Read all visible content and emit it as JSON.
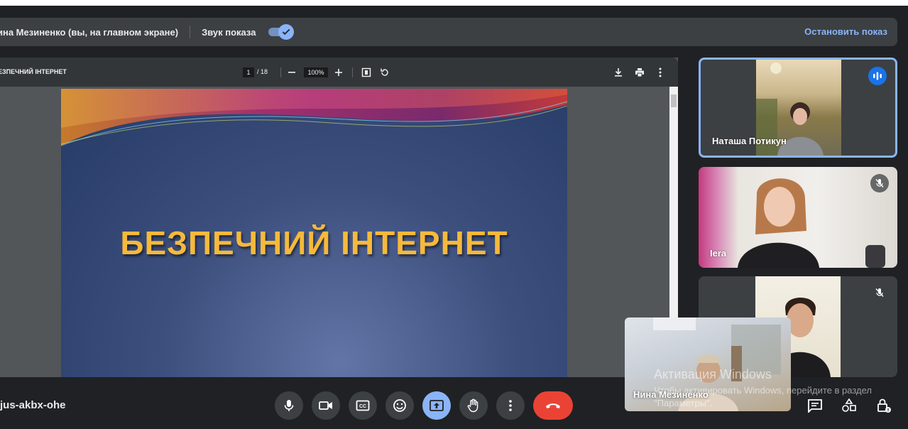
{
  "share_bar": {
    "presenter_text": "ина Мезиненко (вы, на главном экране)",
    "sound_label": "Звук показа",
    "sound_enabled": true,
    "stop_label": "Остановить показ"
  },
  "pdf_viewer": {
    "doc_title": "ЕЗПЕЧНИЙ ІНТЕРНЕТ",
    "current_page": "1",
    "page_total": "/ 18",
    "zoom": "100%",
    "icons": [
      "zoom-out-icon",
      "zoom-in-icon",
      "fit-page-icon",
      "rotate-icon",
      "download-icon",
      "print-icon",
      "more-vert-icon"
    ]
  },
  "slide": {
    "title": "БЕЗПЕЧНИЙ ІНТЕРНЕТ"
  },
  "participants": [
    {
      "name": "Наташа Потикун",
      "status_icon": "speaking-icon",
      "active_speaker": true
    },
    {
      "name": "Iera",
      "status_icon": "mic-off-icon",
      "active_speaker": false
    },
    {
      "name": "",
      "status_icon": "mic-off-icon",
      "active_speaker": false
    }
  ],
  "self_view": {
    "name": "Нина Мезиненко"
  },
  "watermark": {
    "line1": "Активация Windows",
    "line2": "Чтобы активировать Windows, перейдите в раздел \"Параметры\"."
  },
  "meeting": {
    "code": "jus-akbx-ohe"
  },
  "controls": [
    "mic-icon",
    "camera-icon",
    "captions-icon",
    "emoji-icon",
    "present-icon",
    "raise-hand-icon",
    "more-options-icon",
    "end-call-icon"
  ],
  "right_controls": [
    "chat-icon",
    "activities-icon",
    "host-controls-icon"
  ],
  "colors": {
    "accent": "#8ab4f8",
    "end_call": "#ea4335",
    "slide_title": "#f6b93b",
    "background": "#202124"
  }
}
